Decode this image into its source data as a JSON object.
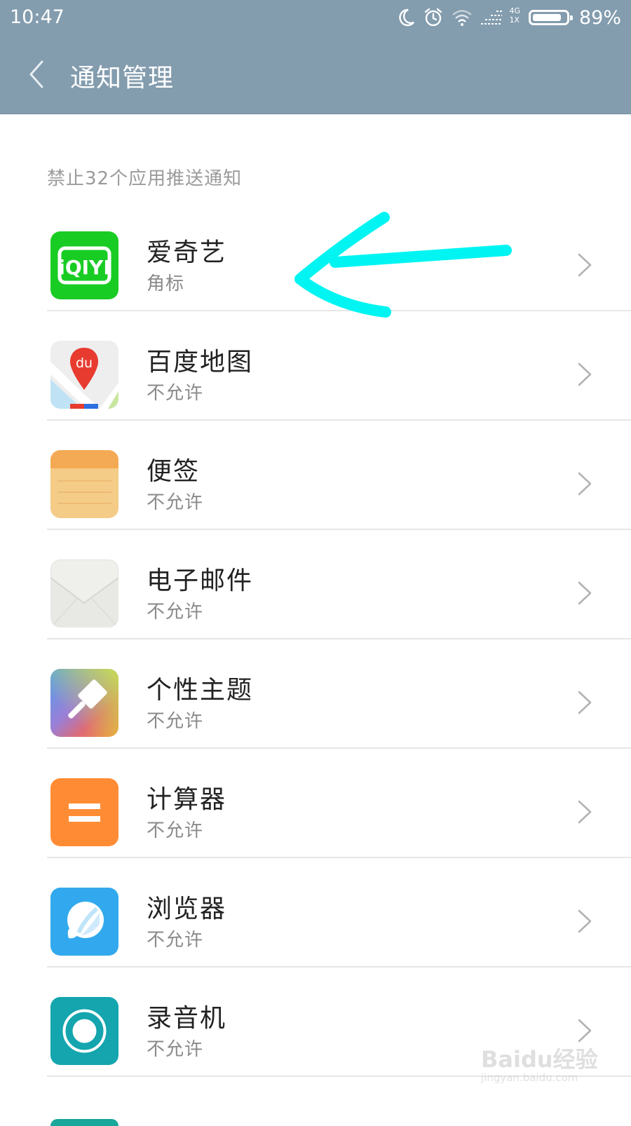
{
  "status_bar": {
    "time": "10:47",
    "network_top": "4G",
    "network_bottom": "1X",
    "battery_percent": "89%",
    "battery_level": 0.89
  },
  "header": {
    "title": "通知管理"
  },
  "section_title": "禁止32个应用推送通知",
  "apps": [
    {
      "name": "爱奇艺",
      "status": "角标",
      "icon": "iqiyi-app-icon"
    },
    {
      "name": "百度地图",
      "status": "不允许",
      "icon": "baidu-map-app-icon"
    },
    {
      "name": "便签",
      "status": "不允许",
      "icon": "notes-app-icon"
    },
    {
      "name": "电子邮件",
      "status": "不允许",
      "icon": "email-app-icon"
    },
    {
      "name": "个性主题",
      "status": "不允许",
      "icon": "themes-app-icon"
    },
    {
      "name": "计算器",
      "status": "不允许",
      "icon": "calculator-app-icon"
    },
    {
      "name": "浏览器",
      "status": "不允许",
      "icon": "browser-app-icon"
    },
    {
      "name": "录音机",
      "status": "不允许",
      "icon": "recorder-app-icon"
    }
  ],
  "icon_labels": {
    "iqiyi": "iQIYI",
    "baidu_map": "du"
  },
  "annotation": {
    "color": "#00f5f2"
  },
  "watermark": {
    "brand": "Baidu经验",
    "url": "jingyan.baidu.com"
  },
  "colors": {
    "header_bg": "#839cae",
    "iqiyi_green": "#19cc24",
    "calculator_orange": "#ff8c35",
    "browser_blue": "#32a9ee",
    "recorder_teal": "#14a5ae"
  }
}
